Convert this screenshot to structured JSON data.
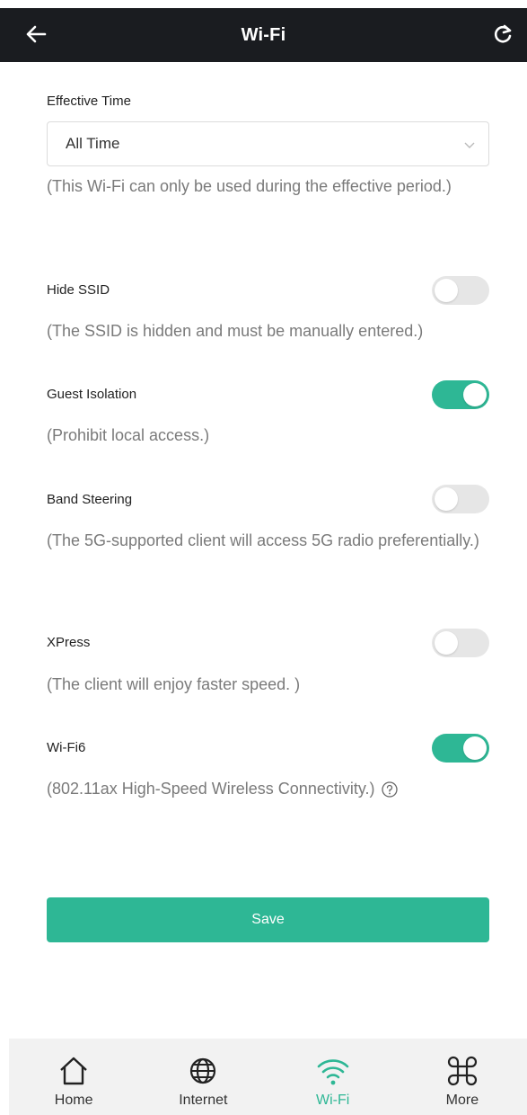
{
  "header": {
    "title": "Wi-Fi",
    "back_icon": "arrow-left-icon",
    "refresh_icon": "refresh-icon"
  },
  "effective_time": {
    "label": "Effective Time",
    "selected": "All Time",
    "description": "(This Wi-Fi can only be used during the effective period.)"
  },
  "settings": [
    {
      "label": "Hide SSID",
      "enabled": false,
      "description": "(The SSID is hidden and must be manually entered.)"
    },
    {
      "label": "Guest Isolation",
      "enabled": true,
      "description": "(Prohibit local access.)"
    },
    {
      "label": "Band Steering",
      "enabled": false,
      "description": "(The 5G-supported client will access 5G radio preferentially.)"
    },
    {
      "label": "XPress",
      "enabled": false,
      "description": "(The client will enjoy faster speed. )"
    },
    {
      "label": "Wi-Fi6",
      "enabled": true,
      "description": "(802.11ax High-Speed Wireless Connectivity.)"
    }
  ],
  "save_label": "Save",
  "nav": [
    {
      "label": "Home",
      "icon": "home-icon",
      "active": false
    },
    {
      "label": "Internet",
      "icon": "globe-icon",
      "active": false
    },
    {
      "label": "Wi-Fi",
      "icon": "wifi-icon",
      "active": true
    },
    {
      "label": "More",
      "icon": "command-icon",
      "active": false
    }
  ],
  "colors": {
    "accent": "#2eb795",
    "header_bg": "#1a1c20",
    "toggle_off": "#e6e6e6",
    "nav_bg": "#f2f2f2"
  }
}
